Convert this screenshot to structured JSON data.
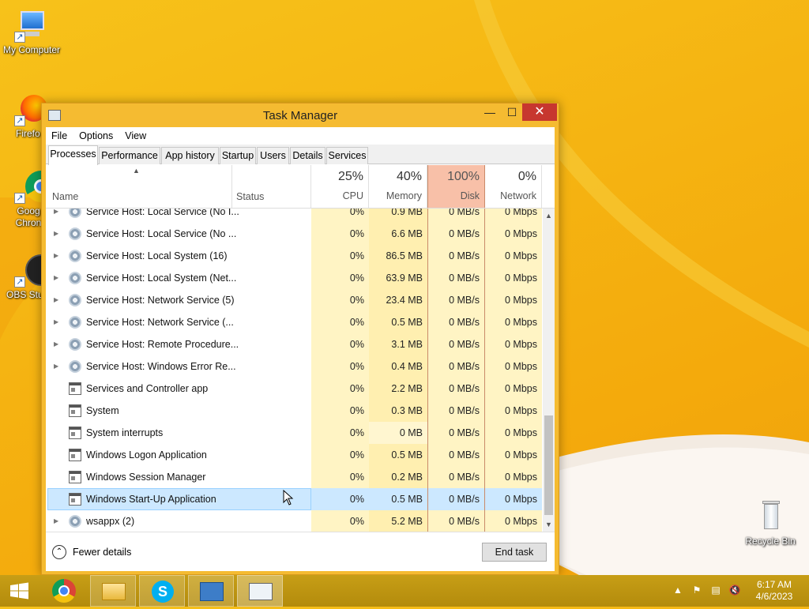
{
  "desktop": {
    "icons": [
      {
        "label": "My Computer"
      },
      {
        "label": "Firefo"
      },
      {
        "label": "Goog Chron"
      },
      {
        "label": "OBS Stu"
      },
      {
        "label": "Recycle Bin"
      }
    ]
  },
  "window": {
    "title": "Task Manager",
    "controls": {
      "minimize": "—",
      "maximize": "☐",
      "close": "✕"
    }
  },
  "menu": [
    "File",
    "Options",
    "View"
  ],
  "tabs": [
    "Processes",
    "Performance",
    "App history",
    "Startup",
    "Users",
    "Details",
    "Services"
  ],
  "active_tab": "Processes",
  "columns": {
    "name": "Name",
    "status": "Status",
    "cpu": {
      "pct": "25%",
      "label": "CPU"
    },
    "memory": {
      "pct": "40%",
      "label": "Memory"
    },
    "disk": {
      "pct": "100%",
      "label": "Disk"
    },
    "network": {
      "pct": "0%",
      "label": "Network"
    }
  },
  "processes": [
    {
      "name": "Service Host: Local Service (No I...",
      "cpu": "0%",
      "memory": "0.9 MB",
      "disk": "0 MB/s",
      "network": "0 Mbps",
      "expandable": true,
      "icon": "gear-icon"
    },
    {
      "name": "Service Host: Local Service (No ...",
      "cpu": "0%",
      "memory": "6.6 MB",
      "disk": "0 MB/s",
      "network": "0 Mbps",
      "expandable": true,
      "icon": "gear-icon"
    },
    {
      "name": "Service Host: Local System (16)",
      "cpu": "0%",
      "memory": "86.5 MB",
      "disk": "0 MB/s",
      "network": "0 Mbps",
      "expandable": true,
      "icon": "gear-icon"
    },
    {
      "name": "Service Host: Local System (Net...",
      "cpu": "0%",
      "memory": "63.9 MB",
      "disk": "0 MB/s",
      "network": "0 Mbps",
      "expandable": true,
      "icon": "gear-icon"
    },
    {
      "name": "Service Host: Network Service (5)",
      "cpu": "0%",
      "memory": "23.4 MB",
      "disk": "0 MB/s",
      "network": "0 Mbps",
      "expandable": true,
      "icon": "gear-icon"
    },
    {
      "name": "Service Host: Network Service (...",
      "cpu": "0%",
      "memory": "0.5 MB",
      "disk": "0 MB/s",
      "network": "0 Mbps",
      "expandable": true,
      "icon": "gear-icon"
    },
    {
      "name": "Service Host: Remote Procedure...",
      "cpu": "0%",
      "memory": "3.1 MB",
      "disk": "0 MB/s",
      "network": "0 Mbps",
      "expandable": true,
      "icon": "gear-icon"
    },
    {
      "name": "Service Host: Windows Error Re...",
      "cpu": "0%",
      "memory": "0.4 MB",
      "disk": "0 MB/s",
      "network": "0 Mbps",
      "expandable": true,
      "icon": "gear-icon"
    },
    {
      "name": "Services and Controller app",
      "cpu": "0%",
      "memory": "2.2 MB",
      "disk": "0 MB/s",
      "network": "0 Mbps",
      "expandable": false,
      "icon": "window-app-icon"
    },
    {
      "name": "System",
      "cpu": "0%",
      "memory": "0.3 MB",
      "disk": "0 MB/s",
      "network": "0 Mbps",
      "expandable": false,
      "icon": "window-app-icon"
    },
    {
      "name": "System interrupts",
      "cpu": "0%",
      "memory": "0 MB",
      "disk": "0 MB/s",
      "network": "0 Mbps",
      "expandable": false,
      "icon": "window-app-icon"
    },
    {
      "name": "Windows Logon Application",
      "cpu": "0%",
      "memory": "0.5 MB",
      "disk": "0 MB/s",
      "network": "0 Mbps",
      "expandable": false,
      "icon": "window-app-icon"
    },
    {
      "name": "Windows Session Manager",
      "cpu": "0%",
      "memory": "0.2 MB",
      "disk": "0 MB/s",
      "network": "0 Mbps",
      "expandable": false,
      "icon": "window-app-icon"
    },
    {
      "name": "Windows Start-Up Application",
      "cpu": "0%",
      "memory": "0.5 MB",
      "disk": "0 MB/s",
      "network": "0 Mbps",
      "expandable": false,
      "icon": "window-app-icon",
      "selected": true
    },
    {
      "name": "wsappx (2)",
      "cpu": "0%",
      "memory": "5.2 MB",
      "disk": "0 MB/s",
      "network": "0 Mbps",
      "expandable": true,
      "icon": "gear-icon"
    }
  ],
  "footer": {
    "fewer_details": "Fewer details",
    "end_task": "End task"
  },
  "taskbar": {
    "apps": [
      "start-button",
      "chrome-icon",
      "file-explorer-icon",
      "skype-icon",
      "control-panel-icon",
      "task-manager-icon"
    ],
    "clock": {
      "time": "6:17 AM",
      "date": "4/6/2023"
    }
  },
  "colors": {
    "accent": "#f5bb31",
    "close": "#c7372f",
    "selection": "#cce8ff",
    "disk_header": "#f8c0a8"
  }
}
